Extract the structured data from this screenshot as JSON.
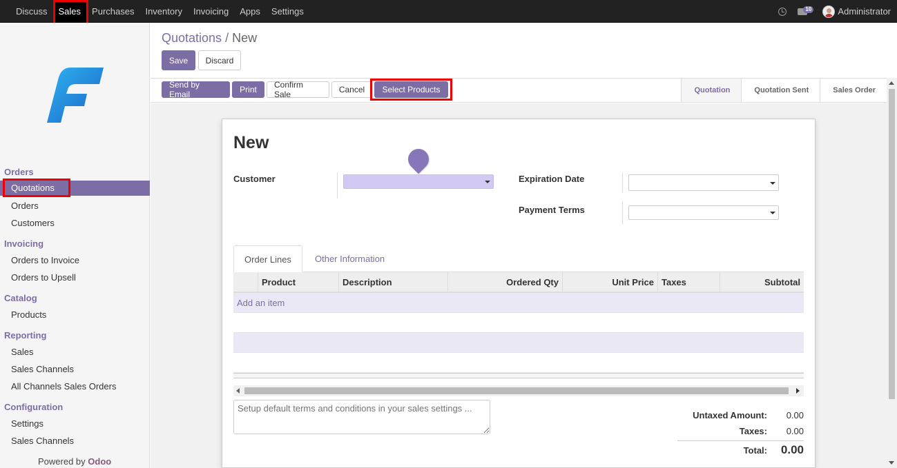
{
  "topbar": {
    "menu": [
      "Discuss",
      "Sales",
      "Purchases",
      "Inventory",
      "Invoicing",
      "Apps",
      "Settings"
    ],
    "active_menu": "Sales",
    "chat_badge": "10",
    "user_name": "Administrator"
  },
  "sidebar": {
    "sections": {
      "orders": "Orders",
      "invoicing": "Invoicing",
      "catalog": "Catalog",
      "reporting": "Reporting",
      "configuration": "Configuration"
    },
    "items": {
      "quotations": "Quotations",
      "orders": "Orders",
      "customers": "Customers",
      "orders_to_invoice": "Orders to Invoice",
      "orders_to_upsell": "Orders to Upsell",
      "products": "Products",
      "sales": "Sales",
      "sales_channels": "Sales Channels",
      "all_channels_sales_orders": "All Channels Sales Orders",
      "settings": "Settings",
      "config_sales_channels": "Sales Channels"
    },
    "powered_prefix": "Powered by ",
    "powered_brand": "Odoo"
  },
  "breadcrumb": {
    "parent": "Quotations",
    "separator": "/",
    "current": "New"
  },
  "buttons": {
    "save": "Save",
    "discard": "Discard",
    "send_by_email": "Send by Email",
    "print": "Print",
    "confirm_sale": "Confirm Sale",
    "cancel": "Cancel",
    "select_products": "Select Products"
  },
  "stages": [
    "Quotation",
    "Quotation Sent",
    "Sales Order"
  ],
  "active_stage": "Quotation",
  "form": {
    "title": "New",
    "customer_label": "Customer",
    "expiration_label": "Expiration Date",
    "payment_terms_label": "Payment Terms"
  },
  "tabs": {
    "order_lines": "Order Lines",
    "other_info": "Other Information"
  },
  "grid": {
    "columns": [
      "Product",
      "Description",
      "Ordered Qty",
      "Unit Price",
      "Taxes",
      "Subtotal"
    ],
    "add_item": "Add an item"
  },
  "terms_placeholder": "Setup default terms and conditions in your sales settings ...",
  "totals": {
    "untaxed_label": "Untaxed Amount:",
    "untaxed_value": "0.00",
    "taxes_label": "Taxes:",
    "taxes_value": "0.00",
    "total_label": "Total:",
    "total_value": "0.00"
  },
  "colors": {
    "accent": "#7c6ea5",
    "highlight": "#ee0000",
    "required_field": "#d2c9f5"
  }
}
